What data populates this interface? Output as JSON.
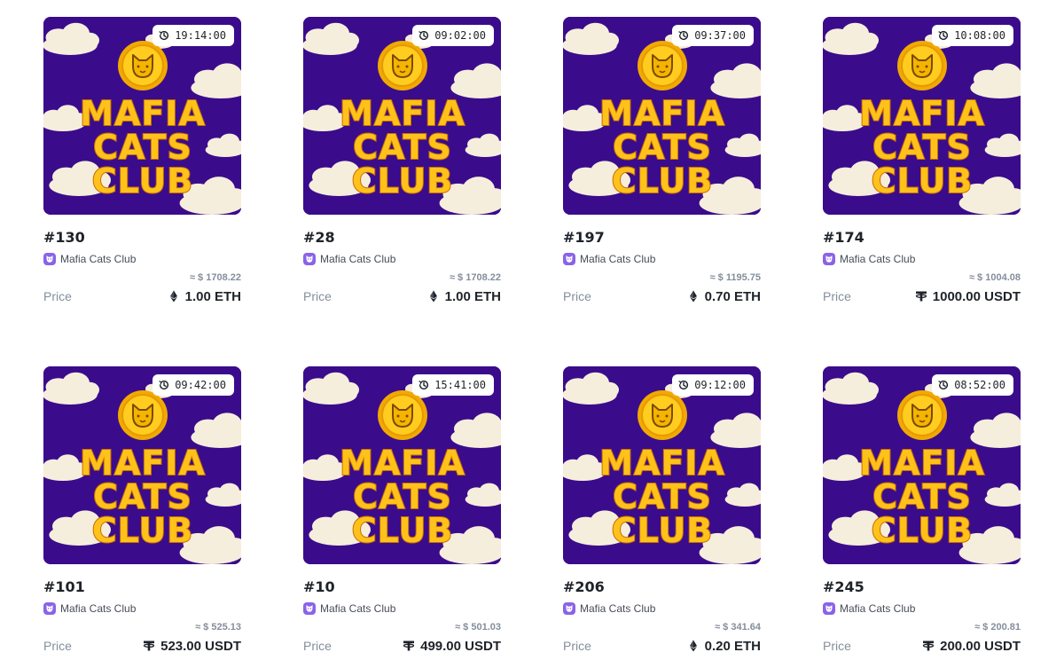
{
  "cards": [
    {
      "timer": "19:14:00",
      "title": "#130",
      "collection": "Mafia Cats Club",
      "usd": "≈ $ 1708.22",
      "price_label": "Price",
      "price": "1.00 ETH",
      "currency": "eth-icon"
    },
    {
      "timer": "09:02:00",
      "title": "#28",
      "collection": "Mafia Cats Club",
      "usd": "≈ $ 1708.22",
      "price_label": "Price",
      "price": "1.00 ETH",
      "currency": "eth-icon"
    },
    {
      "timer": "09:37:00",
      "title": "#197",
      "collection": "Mafia Cats Club",
      "usd": "≈ $ 1195.75",
      "price_label": "Price",
      "price": "0.70 ETH",
      "currency": "eth-icon"
    },
    {
      "timer": "10:08:00",
      "title": "#174",
      "collection": "Mafia Cats Club",
      "usd": "≈ $ 1004.08",
      "price_label": "Price",
      "price": "1000.00 USDT",
      "currency": "usdt-icon"
    },
    {
      "timer": "09:42:00",
      "title": "#101",
      "collection": "Mafia Cats Club",
      "usd": "≈ $ 525.13",
      "price_label": "Price",
      "price": "523.00 USDT",
      "currency": "usdt-icon"
    },
    {
      "timer": "15:41:00",
      "title": "#10",
      "collection": "Mafia Cats Club",
      "usd": "≈ $ 501.03",
      "price_label": "Price",
      "price": "499.00 USDT",
      "currency": "usdt-icon"
    },
    {
      "timer": "09:12:00",
      "title": "#206",
      "collection": "Mafia Cats Club",
      "usd": "≈ $ 341.64",
      "price_label": "Price",
      "price": "0.20 ETH",
      "currency": "eth-icon"
    },
    {
      "timer": "08:52:00",
      "title": "#245",
      "collection": "Mafia Cats Club",
      "usd": "≈ $ 200.81",
      "price_label": "Price",
      "price": "200.00 USDT",
      "currency": "usdt-icon"
    }
  ],
  "artwork": {
    "lines": [
      "MAFIA",
      "CATS",
      "CLUB"
    ],
    "background": "#3a0c8c",
    "text_color": "#ffc21a",
    "cloud_color": "#f6eedc"
  }
}
